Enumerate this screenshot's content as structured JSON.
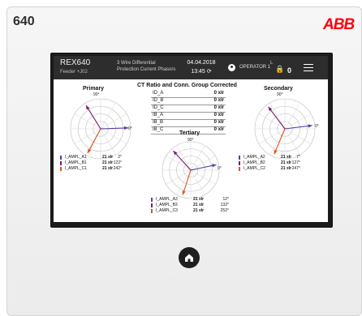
{
  "device": {
    "model_number": "640",
    "brand": "ABB"
  },
  "header": {
    "device_name": "REX640",
    "feeder": "Feeder +J02",
    "title_line1": "3 Wire Differential",
    "title_line2": "Protection Current Phasors",
    "date": "04.04.2018",
    "time": "13:45",
    "user": "OPERATOR 1",
    "lock_level": "L",
    "event_count": "0",
    "colors": {
      "bar": "#2d2d2d"
    }
  },
  "center": {
    "title": "CT Ratio and Conn. Group Corrected",
    "rows": [
      {
        "name": "ID_A",
        "value": "0 xIr"
      },
      {
        "name": "ID_B",
        "value": "0 xIr"
      },
      {
        "name": "ID_C",
        "value": "0 xIr"
      },
      {
        "name": "IB_A",
        "value": "0 xIr"
      },
      {
        "name": "IB_B",
        "value": "0 xIr"
      },
      {
        "name": "IB_C",
        "value": "0 xIr"
      }
    ]
  },
  "primary": {
    "label": "Primary",
    "top_angle": "90°",
    "right_angle": "0°",
    "legend": [
      {
        "name": "I_AMPL_A1",
        "magnitude": "21 xIr",
        "angle": "2°",
        "color": "#5a3ea6"
      },
      {
        "name": "I_AMPL_B1",
        "magnitude": "21 xIr",
        "angle": "122°",
        "color": "#7a1b6e"
      },
      {
        "name": "I_AMPL_C1",
        "magnitude": "21 xIr",
        "angle": "242°",
        "color": "#d4571f"
      }
    ]
  },
  "secondary": {
    "label": "Secondary",
    "top_angle": "90°",
    "right_angle": "0°",
    "legend": [
      {
        "name": "I_AMPL_A2",
        "magnitude": "21 xIr",
        "angle": "7°",
        "color": "#5a3ea6"
      },
      {
        "name": "I_AMPL_B2",
        "magnitude": "21 xIr",
        "angle": "127°",
        "color": "#7a1b6e"
      },
      {
        "name": "I_AMPL_C2",
        "magnitude": "21 xIr",
        "angle": "247°",
        "color": "#d4571f"
      }
    ]
  },
  "tertiary": {
    "label": "Tertiary",
    "top_angle": "90°",
    "right_angle": "0°",
    "legend": [
      {
        "name": "I_AMPL_A3",
        "magnitude": "21 xIr",
        "angle": "12°",
        "color": "#5a3ea6"
      },
      {
        "name": "I_AMPL_B3",
        "magnitude": "21 xIr",
        "angle": "132°",
        "color": "#7a1b6e"
      },
      {
        "name": "I_AMPL_C3",
        "magnitude": "21 xIr",
        "angle": "252°",
        "color": "#d4571f"
      }
    ]
  },
  "icons": {
    "user": "user-icon",
    "lock": "lock-icon",
    "menu": "hamburger-menu-icon",
    "home": "home-icon",
    "sync": "sync-icon"
  }
}
